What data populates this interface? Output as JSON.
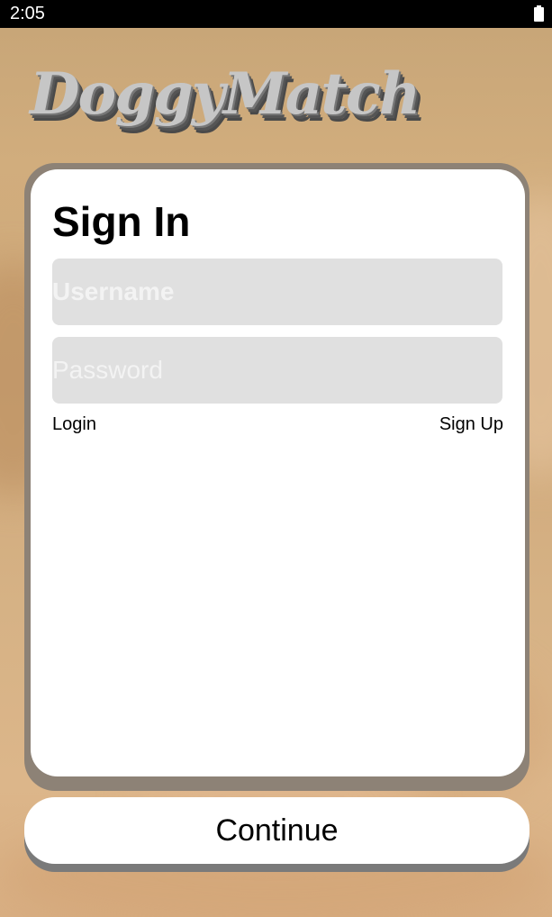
{
  "status_bar": {
    "time": "2:05"
  },
  "app": {
    "logo_text": "DoggyMatch"
  },
  "sign_in": {
    "title": "Sign In",
    "username_placeholder": "Username",
    "password_placeholder": "Password",
    "login_label": "Login",
    "signup_label": "Sign Up"
  },
  "footer": {
    "continue_label": "Continue"
  },
  "colors": {
    "status_bar": "#000000",
    "card": "#ffffff",
    "field": "#e0e0e0",
    "card_shadow": "#8d8276"
  }
}
